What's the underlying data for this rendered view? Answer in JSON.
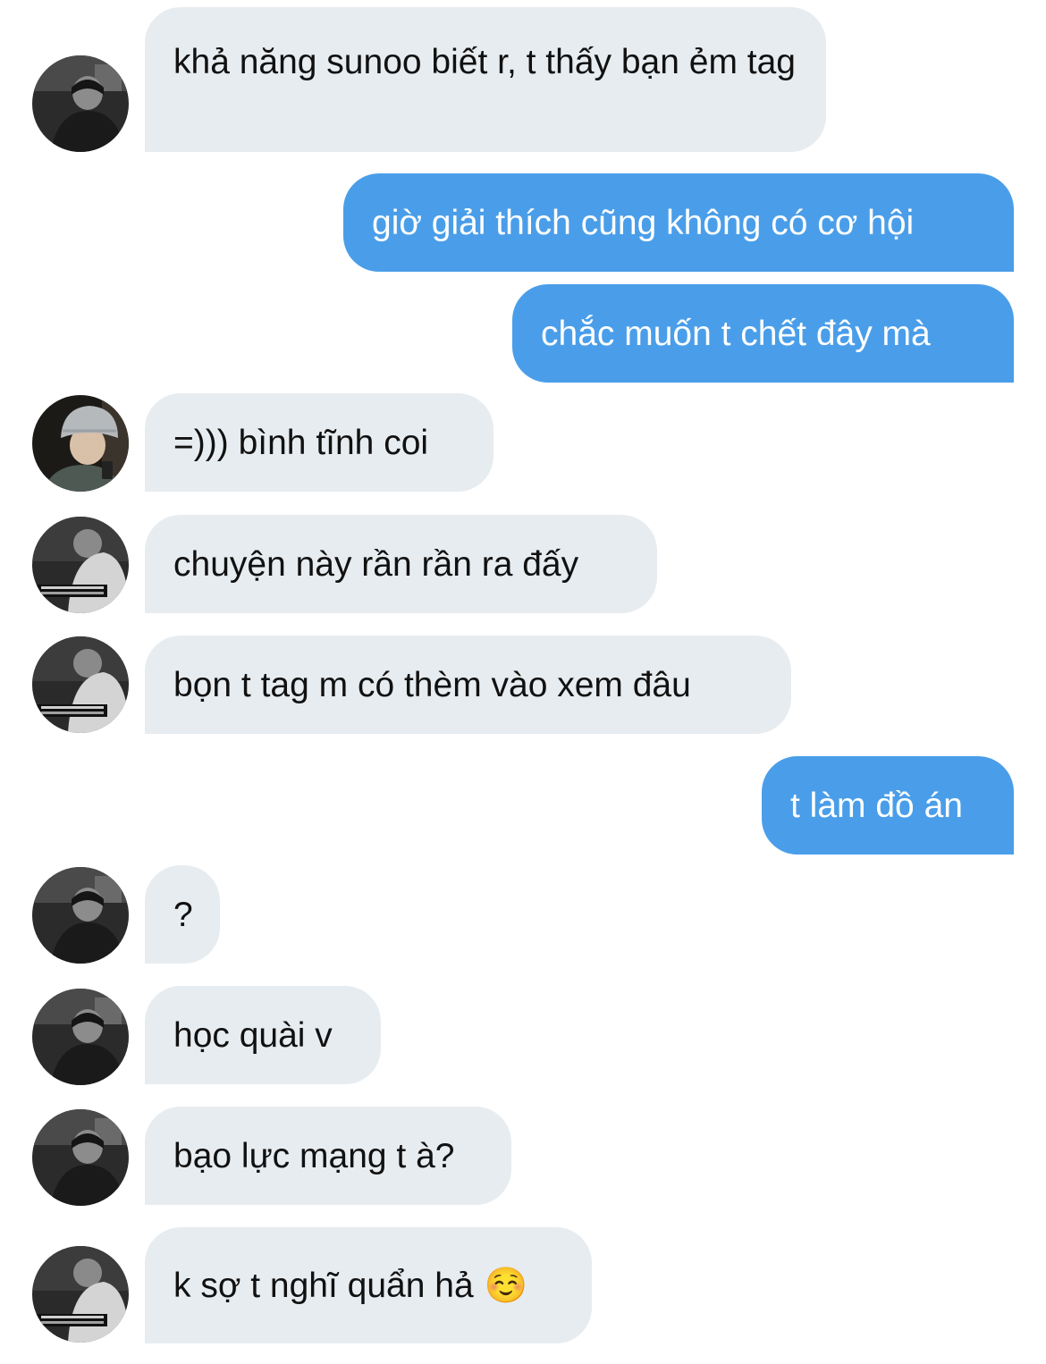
{
  "messages": [
    {
      "side": "in",
      "text": "khả năng sunoo biết r, t thấy bạn ẻm tag",
      "avatar": "avatar-dark-hair"
    },
    {
      "side": "out",
      "text": "giờ giải thích cũng không có cơ hội"
    },
    {
      "side": "out",
      "text": "chắc muốn t chết đây mà"
    },
    {
      "side": "in",
      "text": "=))) bình tĩnh coi",
      "avatar": "avatar-beanie"
    },
    {
      "side": "in",
      "text": "chuyện này rần rần ra đấy",
      "avatar": "avatar-guitar"
    },
    {
      "side": "in",
      "text": "bọn t tag m có thèm vào xem đâu",
      "avatar": "avatar-guitar"
    },
    {
      "side": "out",
      "text": "t làm đồ án"
    },
    {
      "side": "in",
      "text": "?",
      "avatar": "avatar-dark-hair"
    },
    {
      "side": "in",
      "text": "học quài v",
      "avatar": "avatar-dark-hair"
    },
    {
      "side": "in",
      "text": "bạo lực mạng t à?",
      "avatar": "avatar-dark-hair"
    },
    {
      "side": "in",
      "text": "k sợ t nghĩ quẩn hả",
      "emoji": "☺️",
      "avatar": "avatar-guitar"
    }
  ],
  "colors": {
    "incoming_bubble": "#e7ecf0",
    "outgoing_bubble": "#4a9ee9",
    "incoming_text": "#111111",
    "outgoing_text": "#ffffff"
  }
}
